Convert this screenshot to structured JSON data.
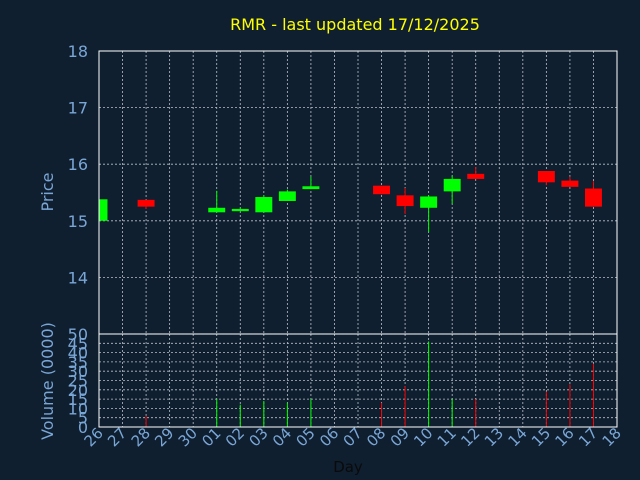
{
  "colors": {
    "background": "#0f1f30",
    "panel_border": "#ffffff",
    "grid": "#b8c0c8",
    "title": "#ffff00",
    "axis_text": "#7aa6d6",
    "up": "#00ff00",
    "down": "#ff0000"
  },
  "chart_data": {
    "type": "candlestick",
    "title": "RMR - last updated 17/12/2025",
    "xlabel": "Day",
    "ylabel": "Price",
    "volume_label": "Volume (0000)",
    "price_ylim": [
      13.0,
      18.0
    ],
    "price_yticks": [
      "14",
      "15",
      "16",
      "17",
      "18"
    ],
    "volume_ylim": [
      0,
      50
    ],
    "volume_yticks": [
      "0",
      "5",
      "10",
      "15",
      "20",
      "25",
      "30",
      "35",
      "40",
      "45",
      "50"
    ],
    "grid": true,
    "x_ticks": [
      "26",
      "27",
      "28",
      "29",
      "30",
      "01",
      "02",
      "03",
      "04",
      "05",
      "06",
      "07",
      "08",
      "09",
      "10",
      "11",
      "12",
      "13",
      "14",
      "15",
      "16",
      "17",
      "18"
    ],
    "candles": [
      {
        "day": "26",
        "open": 15.0,
        "close": 15.38,
        "high": 15.38,
        "low": 15.0,
        "volume": 0
      },
      {
        "day": "28",
        "open": 15.37,
        "close": 15.25,
        "high": 15.37,
        "low": 15.21,
        "volume": 6
      },
      {
        "day": "01",
        "open": 15.15,
        "close": 15.23,
        "high": 15.53,
        "low": 15.15,
        "volume": 15
      },
      {
        "day": "02",
        "open": 15.17,
        "close": 15.21,
        "high": 15.23,
        "low": 15.17,
        "volume": 12
      },
      {
        "day": "03",
        "open": 15.15,
        "close": 15.42,
        "high": 15.45,
        "low": 15.15,
        "volume": 14
      },
      {
        "day": "04",
        "open": 15.35,
        "close": 15.52,
        "high": 15.55,
        "low": 15.35,
        "volume": 13
      },
      {
        "day": "05",
        "open": 15.56,
        "close": 15.61,
        "high": 15.78,
        "low": 15.56,
        "volume": 15
      },
      {
        "day": "08",
        "open": 15.62,
        "close": 15.47,
        "high": 15.62,
        "low": 15.47,
        "volume": 13
      },
      {
        "day": "09",
        "open": 15.45,
        "close": 15.26,
        "high": 15.58,
        "low": 15.12,
        "volume": 22
      },
      {
        "day": "10",
        "open": 15.23,
        "close": 15.43,
        "high": 15.45,
        "low": 14.8,
        "volume": 46
      },
      {
        "day": "11",
        "open": 15.52,
        "close": 15.74,
        "high": 15.8,
        "low": 15.3,
        "volume": 15
      },
      {
        "day": "12",
        "open": 15.83,
        "close": 15.74,
        "high": 15.95,
        "low": 15.74,
        "volume": 15
      },
      {
        "day": "15",
        "open": 15.88,
        "close": 15.68,
        "high": 15.88,
        "low": 15.63,
        "volume": 19
      },
      {
        "day": "16",
        "open": 15.71,
        "close": 15.6,
        "high": 15.78,
        "low": 15.6,
        "volume": 23
      },
      {
        "day": "17",
        "open": 15.57,
        "close": 15.25,
        "high": 15.7,
        "low": 15.25,
        "volume": 34
      }
    ]
  }
}
